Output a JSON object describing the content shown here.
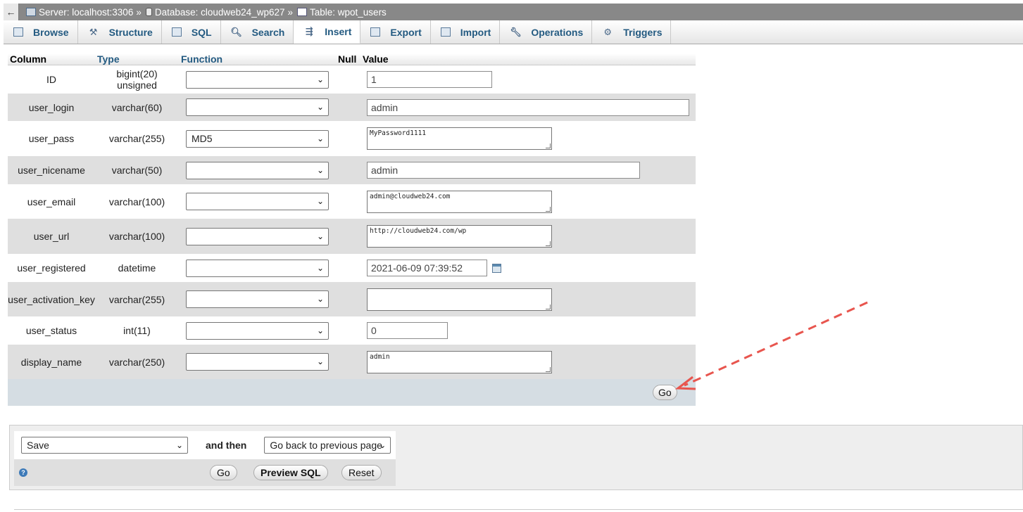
{
  "breadcrumb": {
    "back_label": "←",
    "server": "Server: localhost:3306",
    "database": "Database: cloudweb24_wp627",
    "table": "Table: wpot_users",
    "separator": "»"
  },
  "tabs": [
    {
      "label": "Browse",
      "icon": "browse-icon"
    },
    {
      "label": "Structure",
      "icon": "structure-icon"
    },
    {
      "label": "SQL",
      "icon": "sql-icon"
    },
    {
      "label": "Search",
      "icon": "search-icon"
    },
    {
      "label": "Insert",
      "icon": "insert-icon",
      "active": true
    },
    {
      "label": "Export",
      "icon": "export-icon"
    },
    {
      "label": "Import",
      "icon": "import-icon"
    },
    {
      "label": "Operations",
      "icon": "wrench-icon"
    },
    {
      "label": "Triggers",
      "icon": "triggers-icon"
    }
  ],
  "grid": {
    "headers": {
      "column": "Column",
      "type": "Type",
      "function": "Function",
      "null": "Null",
      "value": "Value"
    },
    "rows": [
      {
        "column": "ID",
        "type": "bigint(20) unsigned",
        "function": "",
        "value": "1"
      },
      {
        "column": "user_login",
        "type": "varchar(60)",
        "function": "",
        "value": "admin"
      },
      {
        "column": "user_pass",
        "type": "varchar(255)",
        "function": "MD5",
        "value": "MyPassword1111"
      },
      {
        "column": "user_nicename",
        "type": "varchar(50)",
        "function": "",
        "value": "admin"
      },
      {
        "column": "user_email",
        "type": "varchar(100)",
        "function": "",
        "value": "admin@cloudweb24.com"
      },
      {
        "column": "user_url",
        "type": "varchar(100)",
        "function": "",
        "value": "http://cloudweb24.com/wp"
      },
      {
        "column": "user_registered",
        "type": "datetime",
        "function": "",
        "value": "2021-06-09 07:39:52"
      },
      {
        "column": "user_activation_key",
        "type": "varchar(255)",
        "function": "",
        "value": ""
      },
      {
        "column": "user_status",
        "type": "int(11)",
        "function": "",
        "value": "0"
      },
      {
        "column": "display_name",
        "type": "varchar(250)",
        "function": "",
        "value": "admin"
      }
    ],
    "go_label": "Go"
  },
  "actions": {
    "save_option": "Save",
    "and_then": "and then",
    "after_option": "Go back to previous page",
    "help_label": "?",
    "go_label": "Go",
    "preview_label": "Preview SQL",
    "reset_label": "Reset"
  },
  "colors": {
    "annotation_arrow": "#e8554e",
    "tab_text": "#235a81"
  }
}
